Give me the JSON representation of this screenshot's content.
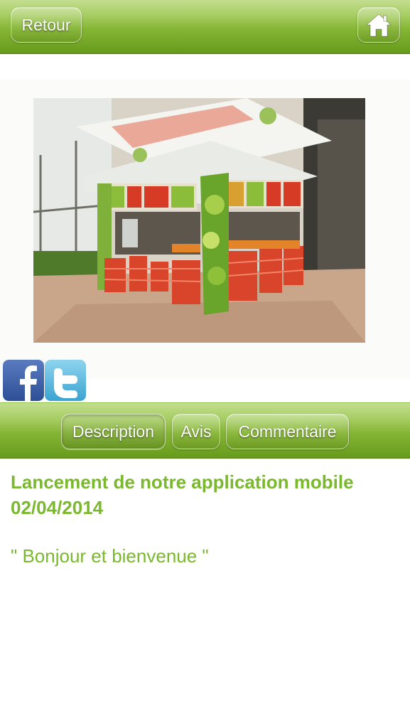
{
  "header": {
    "back_label": "Retour",
    "home_icon": "home-icon"
  },
  "media": {
    "photo_icon": "photo-kiosk"
  },
  "share": {
    "facebook_icon": "facebook-icon",
    "twitter_icon": "twitter-icon"
  },
  "tabs": [
    {
      "label": "Description",
      "selected": true
    },
    {
      "label": "Avis",
      "selected": false
    },
    {
      "label": "Commentaire",
      "selected": false
    }
  ],
  "content": {
    "title_line1": "Lancement de notre application mobile",
    "title_line2": "02/04/2014",
    "body": "\" Bonjour et bienvenue \""
  },
  "colors": {
    "accent_green": "#7ab82e",
    "bar_dark_green": "#679a1c",
    "bar_light_green": "#c3de8f"
  }
}
